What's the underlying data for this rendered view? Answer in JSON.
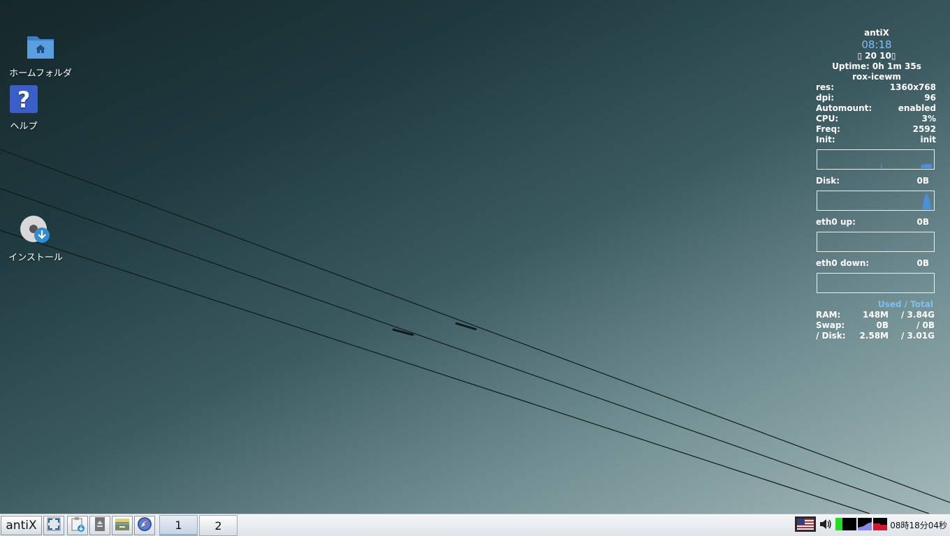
{
  "desktop": {
    "icons": [
      {
        "label": "ホームフォルダ",
        "icon": "home-folder-icon"
      },
      {
        "label": "ヘルプ",
        "icon": "help-icon"
      },
      {
        "label": "インストール",
        "icon": "install-disc-icon"
      }
    ]
  },
  "conky": {
    "distro": "antiX",
    "time": "08:18",
    "date": "20 10",
    "uptime": "Uptime: 0h 1m 35s",
    "session": "rox-icewm",
    "stats": [
      {
        "label": "res:",
        "value": "1360x768"
      },
      {
        "label": "dpi:",
        "value": "96"
      },
      {
        "label": "Automount:",
        "value": "enabled"
      },
      {
        "label": "CPU:",
        "value": "3%"
      },
      {
        "label": "Freq:",
        "value": "2592"
      },
      {
        "label": "Init:",
        "value": "init"
      }
    ],
    "disk": {
      "label": "Disk:",
      "value": "0B"
    },
    "eth_up": {
      "label": "eth0 up:",
      "value": "0B"
    },
    "eth_down": {
      "label": "eth0 down:",
      "value": "0B"
    },
    "mem_header": "Used / Total",
    "mem": [
      {
        "label": "RAM:",
        "used": "148M",
        "total": "/ 3.84G"
      },
      {
        "label": "Swap:",
        "used": "0B",
        "total": "/ 0B"
      },
      {
        "label": "/ Disk:",
        "used": "2.58M",
        "total": "/ 3.01G"
      }
    ],
    "graph_color": "#4a90d9"
  },
  "taskbar": {
    "start_label": "antiX",
    "quicklaunch": [
      "fullscreen-icon",
      "install-clipboard-icon",
      "eject-icon",
      "file-manager-icon",
      "browser-compass-icon"
    ],
    "workspaces": [
      {
        "label": "1",
        "active": true
      },
      {
        "label": "2",
        "active": false
      }
    ],
    "tray": {
      "keyboard_layout": "us-flag-icon",
      "volume": "volume-icon",
      "clock": "08時18分04秒"
    }
  }
}
